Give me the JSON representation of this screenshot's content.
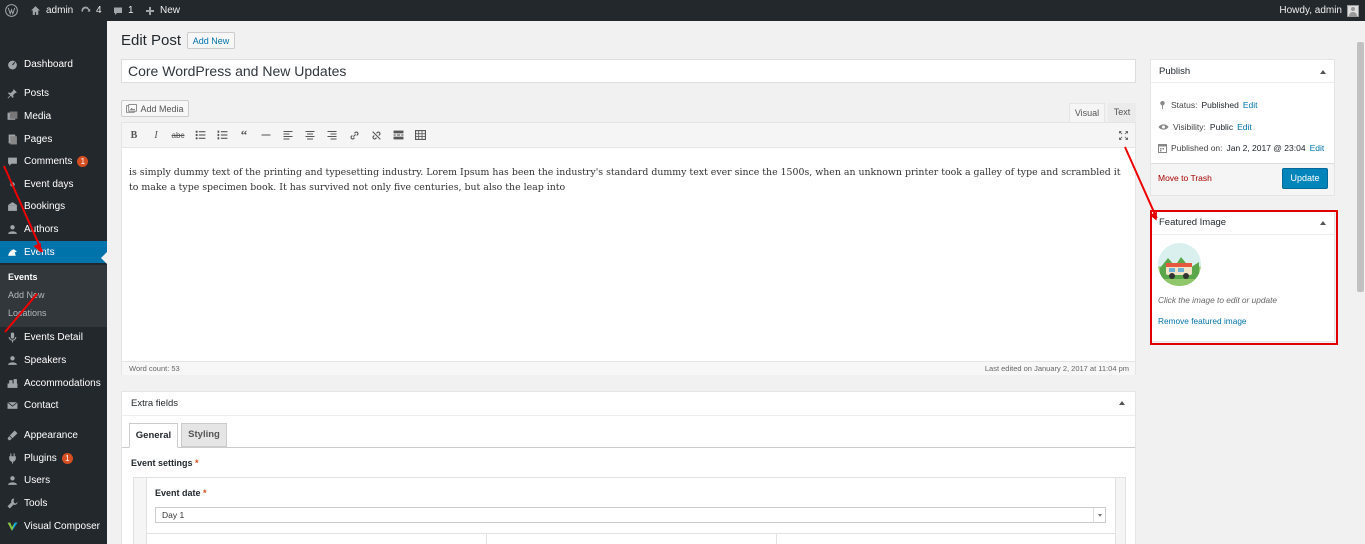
{
  "admin_bar": {
    "site_name": "admin",
    "updates_count": "4",
    "comments_count": "1",
    "new_label": "New",
    "howdy": "Howdy, admin"
  },
  "sidebar": {
    "items": [
      {
        "label": "Dashboard",
        "icon": "dashboard-icon"
      },
      {
        "label": "Posts",
        "icon": "pin-icon"
      },
      {
        "label": "Media",
        "icon": "media-icon"
      },
      {
        "label": "Pages",
        "icon": "pages-icon"
      },
      {
        "label": "Comments",
        "icon": "comments-icon",
        "badge": "1"
      },
      {
        "label": "Event days",
        "icon": "generic-icon"
      },
      {
        "label": "Bookings",
        "icon": "bookings-icon"
      },
      {
        "label": "Authors",
        "icon": "user-icon"
      },
      {
        "label": "Events",
        "icon": "events-icon"
      },
      {
        "label": "Events Detail",
        "icon": "microphone-icon"
      },
      {
        "label": "Speakers",
        "icon": "speakers-icon"
      },
      {
        "label": "Accommodations",
        "icon": "accommodations-icon"
      },
      {
        "label": "Contact",
        "icon": "mail-icon"
      },
      {
        "label": "Appearance",
        "icon": "appearance-icon"
      },
      {
        "label": "Plugins",
        "icon": "plugins-icon",
        "badge": "1"
      },
      {
        "label": "Users",
        "icon": "users-icon"
      },
      {
        "label": "Tools",
        "icon": "tools-icon"
      },
      {
        "label": "Visual Composer",
        "icon": "visual-composer-icon"
      }
    ],
    "submenu": [
      "Events",
      "Add New",
      "Locations"
    ]
  },
  "header": {
    "title": "Edit Post",
    "add_new": "Add New"
  },
  "post": {
    "title": "Core WordPress and New Updates"
  },
  "editor": {
    "add_media": "Add Media",
    "tab_visual": "Visual",
    "tab_text": "Text",
    "content": "is simply dummy text of the printing and typesetting industry. Lorem Ipsum has been the industry's standard dummy text ever since the 1500s, when an unknown printer took a galley of type and scrambled it to make a type specimen book. It has survived not only five centuries, but also the leap into",
    "word_count": "Word count: 53",
    "last_edited": "Last edited on January 2, 2017 at 11:04 pm"
  },
  "publish": {
    "title": "Publish",
    "status_label": "Status:",
    "status_value": "Published",
    "visibility_label": "Visibility:",
    "visibility_value": "Public",
    "published_label": "Published on:",
    "published_value": "Jan 2, 2017 @ 23:04",
    "edit": "Edit",
    "trash": "Move to Trash",
    "update": "Update"
  },
  "featured": {
    "title": "Featured Image",
    "hint": "Click the image to edit or update",
    "remove": "Remove featured image"
  },
  "extra": {
    "title": "Extra fields",
    "tab_general": "General",
    "tab_styling": "Styling",
    "event_settings": "Event settings",
    "event_date": "Event date",
    "required": "*",
    "day_value": "Day 1"
  },
  "colors": {
    "accent": "#0073aa",
    "admin_dark": "#23282d",
    "highlight_red": "#e00000"
  }
}
